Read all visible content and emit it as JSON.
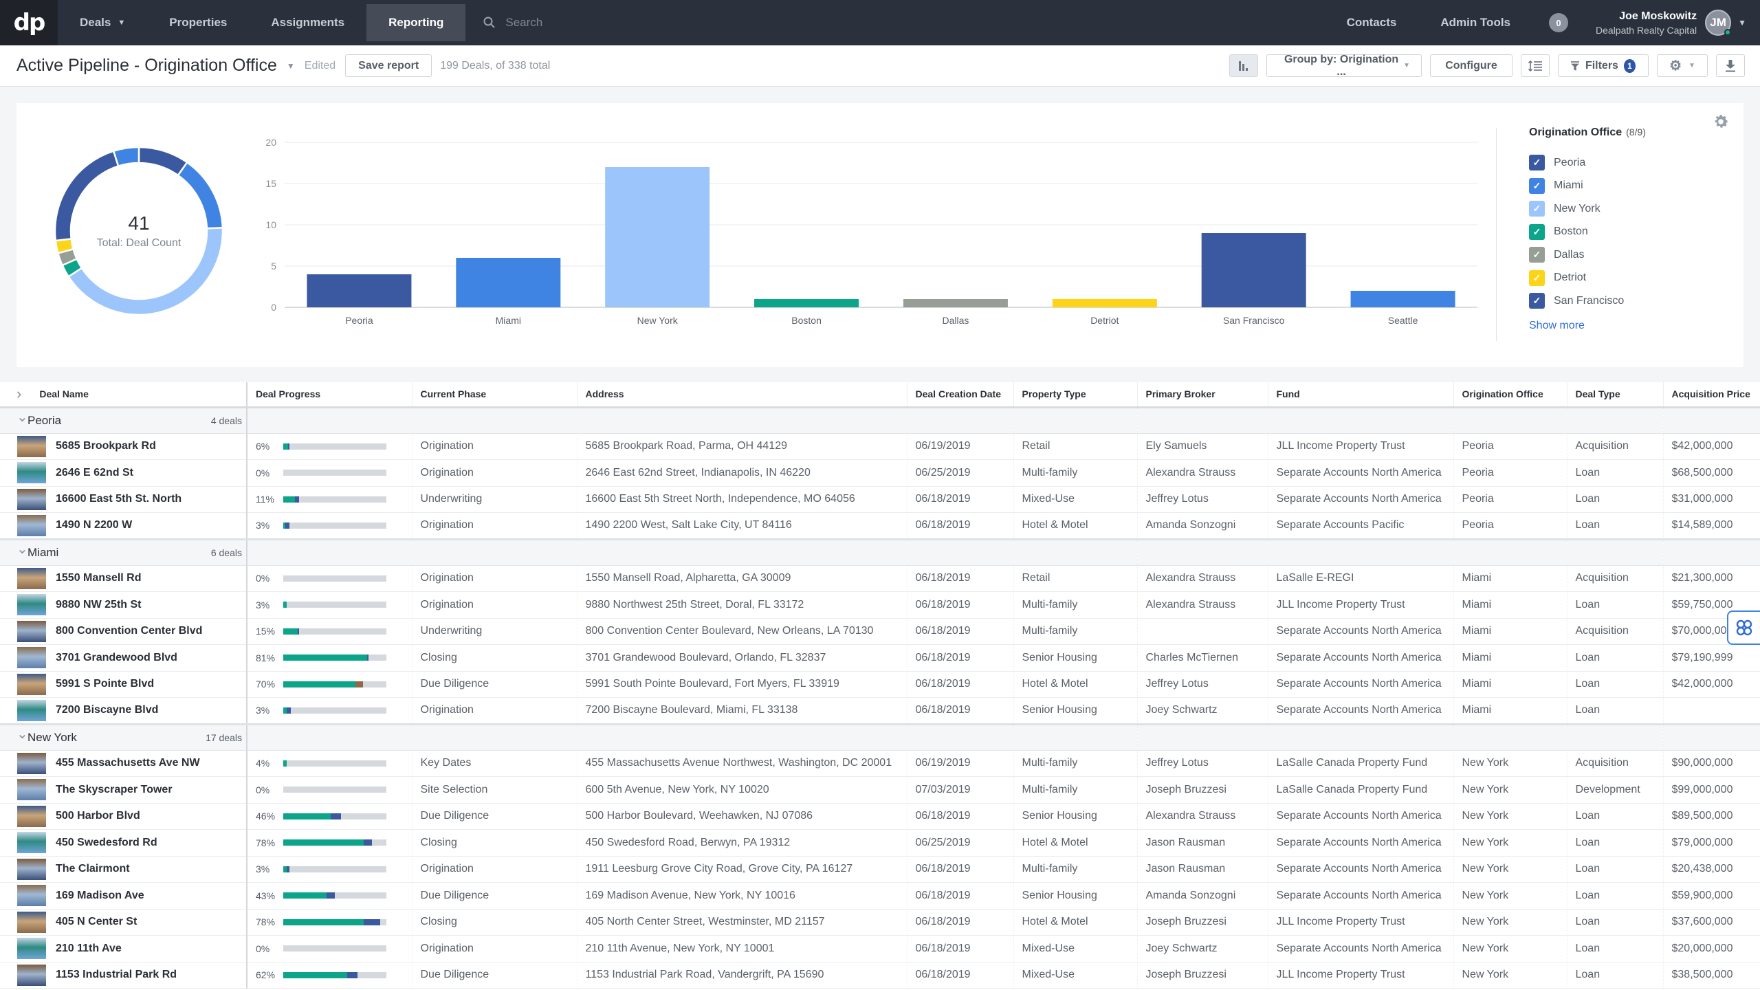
{
  "nav": {
    "logo": "dp",
    "items": [
      {
        "label": "Deals",
        "has_caret": true,
        "active": false
      },
      {
        "label": "Properties",
        "active": false
      },
      {
        "label": "Assignments",
        "active": false
      },
      {
        "label": "Reporting",
        "active": true
      }
    ],
    "search_placeholder": "Search",
    "right_links": [
      "Contacts",
      "Admin Tools"
    ],
    "notification_count": "0",
    "user": {
      "name": "Joe Moskowitz",
      "org": "Dealpath Realty Capital",
      "initials": "JM"
    }
  },
  "titlebar": {
    "title": "Active Pipeline - Origination Office",
    "edited": "Edited",
    "save_label": "Save report",
    "deal_count": "199 Deals, of 338 total",
    "group_by_label": "Group by: Origination ...",
    "configure_label": "Configure",
    "filters_label": "Filters",
    "filters_count": "1"
  },
  "colors": {
    "Peoria": "#3b59a0",
    "Miami": "#4084e3",
    "New York": "#9cc5fb",
    "Boston": "#0ca58a",
    "Dallas": "#979e96",
    "Detriot": "#fdd418",
    "San Francisco": "#3b59a0",
    "Seattle": "#4084e3",
    "progress_primary": "#0ca58a",
    "progress_blue": "#3b59a0",
    "progress_brown": "#8e6a4a",
    "link": "#2d6bd6"
  },
  "chart_data": [
    {
      "type": "pie",
      "variant": "donut",
      "title": "Total: Deal Count",
      "center_value": "41",
      "center_label": "Total: Deal Count",
      "categories": [
        "Peoria",
        "Miami",
        "New York",
        "Boston",
        "Dallas",
        "Detriot",
        "San Francisco",
        "Seattle"
      ],
      "values": [
        4,
        6,
        17,
        1,
        1,
        1,
        9,
        2
      ]
    },
    {
      "type": "bar",
      "title": "",
      "xlabel": "",
      "ylabel": "",
      "categories": [
        "Peoria",
        "Miami",
        "New York",
        "Boston",
        "Dallas",
        "Detriot",
        "San Francisco",
        "Seattle"
      ],
      "values": [
        4,
        6,
        17,
        1,
        1,
        1,
        9,
        2
      ],
      "ylim": [
        0,
        20
      ],
      "yticks": [
        0,
        5,
        10,
        15,
        20
      ],
      "grid": true
    }
  ],
  "legend": {
    "title": "Origination Office",
    "count": "(8/9)",
    "items": [
      "Peoria",
      "Miami",
      "New York",
      "Boston",
      "Dallas",
      "Detriot",
      "San Francisco"
    ],
    "show_more": "Show more"
  },
  "table": {
    "columns": [
      "Deal Name",
      "Deal Progress",
      "Current Phase",
      "Address",
      "Deal Creation Date",
      "Property Type",
      "Primary Broker",
      "Fund",
      "Origination Office",
      "Deal Type",
      "Acquisition Price"
    ],
    "groups": [
      {
        "name": "Peoria",
        "count": "4 deals",
        "rows": [
          {
            "name": "5685 Brookpark Rd",
            "progress": 6,
            "segments": [
              [
                0.045,
                "progress_primary"
              ],
              [
                0.015,
                "progress_blue"
              ]
            ],
            "phase": "Origination",
            "address": "5685 Brookpark Road, Parma, OH 44129",
            "date": "06/19/2019",
            "type": "Retail",
            "broker": "Ely Samuels",
            "fund": "JLL Income Property Trust",
            "office": "Peoria",
            "deal_type": "Acquisition",
            "price": "$42,000,000"
          },
          {
            "name": "2646 E 62nd St",
            "progress": 0,
            "segments": [],
            "phase": "Origination",
            "address": "2646 East 62nd Street, Indianapolis, IN 46220",
            "date": "06/25/2019",
            "type": "Multi-family",
            "broker": "Alexandra Strauss",
            "fund": "Separate Accounts North America",
            "office": "Peoria",
            "deal_type": "Loan",
            "price": "$68,500,000"
          },
          {
            "name": "16600 East 5th St. North",
            "progress": 11,
            "segments": [
              [
                0.11,
                "progress_primary"
              ],
              [
                0.04,
                "progress_blue"
              ]
            ],
            "phase": "Underwriting",
            "address": "16600 East 5th Street North, Independence, MO 64056",
            "date": "06/18/2019",
            "type": "Mixed-Use",
            "broker": "Jeffrey Lotus",
            "fund": "Separate Accounts North America",
            "office": "Peoria",
            "deal_type": "Loan",
            "price": "$31,000,000"
          },
          {
            "name": "1490 N 2200 W",
            "progress": 3,
            "segments": [
              [
                0.02,
                "progress_primary"
              ],
              [
                0.04,
                "progress_blue"
              ]
            ],
            "phase": "Origination",
            "address": "1490 2200 West, Salt Lake City, UT 84116",
            "date": "06/18/2019",
            "type": "Hotel & Motel",
            "broker": "Amanda Sonzogni",
            "fund": "Separate Accounts Pacific",
            "office": "Peoria",
            "deal_type": "Loan",
            "price": "$14,589,000"
          }
        ]
      },
      {
        "name": "Miami",
        "count": "6 deals",
        "rows": [
          {
            "name": "1550 Mansell Rd",
            "progress": 0,
            "segments": [],
            "phase": "Origination",
            "address": "1550 Mansell Road, Alpharetta, GA 30009",
            "date": "06/18/2019",
            "type": "Retail",
            "broker": "Alexandra Strauss",
            "fund": "LaSalle E-REGI",
            "office": "Miami",
            "deal_type": "Acquisition",
            "price": "$21,300,000"
          },
          {
            "name": "9880 NW 25th St",
            "progress": 3,
            "segments": [
              [
                0.03,
                "progress_primary"
              ]
            ],
            "phase": "Origination",
            "address": "9880 Northwest 25th Street, Doral, FL 33172",
            "date": "06/18/2019",
            "type": "Multi-family",
            "broker": "Alexandra Strauss",
            "fund": "JLL Income Property Trust",
            "office": "Miami",
            "deal_type": "Loan",
            "price": "$59,750,000"
          },
          {
            "name": "800 Convention Center Blvd",
            "progress": 15,
            "segments": [
              [
                0.14,
                "progress_primary"
              ],
              [
                0.01,
                "progress_blue"
              ]
            ],
            "phase": "Underwriting",
            "address": "800 Convention Center Boulevard, New Orleans, LA 70130",
            "date": "06/18/2019",
            "type": "Multi-family",
            "broker": "",
            "fund": "Separate Accounts North America",
            "office": "Miami",
            "deal_type": "Acquisition",
            "price": "$70,000,000"
          },
          {
            "name": "3701 Grandewood Blvd",
            "progress": 81,
            "segments": [
              [
                0.81,
                "progress_primary"
              ],
              [
                0.015,
                "progress_blue"
              ]
            ],
            "phase": "Closing",
            "address": "3701 Grandewood Boulevard, Orlando, FL 32837",
            "date": "06/18/2019",
            "type": "Senior Housing",
            "broker": "Charles McTiernen",
            "fund": "Separate Accounts North America",
            "office": "Miami",
            "deal_type": "Loan",
            "price": "$79,190,999"
          },
          {
            "name": "5991 S Pointe Blvd",
            "progress": 70,
            "segments": [
              [
                0.7,
                "progress_primary"
              ],
              [
                0.07,
                "progress_brown"
              ]
            ],
            "phase": "Due Diligence",
            "address": "5991 South Pointe Boulevard, Fort Myers, FL 33919",
            "date": "06/18/2019",
            "type": "Hotel & Motel",
            "broker": "Jeffrey Lotus",
            "fund": "Separate Accounts North America",
            "office": "Miami",
            "deal_type": "Loan",
            "price": "$42,000,000"
          },
          {
            "name": "7200 Biscayne Blvd",
            "progress": 3,
            "segments": [
              [
                0.03,
                "progress_primary"
              ],
              [
                0.04,
                "progress_blue"
              ]
            ],
            "phase": "Origination",
            "address": "7200 Biscayne Boulevard, Miami, FL 33138",
            "date": "06/18/2019",
            "type": "Senior Housing",
            "broker": "Joey Schwartz",
            "fund": "Separate Accounts North America",
            "office": "Miami",
            "deal_type": "Loan",
            "price": ""
          }
        ]
      },
      {
        "name": "New York",
        "count": "17 deals",
        "rows": [
          {
            "name": "455 Massachusetts Ave NW",
            "progress": 4,
            "segments": [
              [
                0.035,
                "progress_primary"
              ]
            ],
            "phase": "Key Dates",
            "address": "455 Massachusetts Avenue Northwest, Washington, DC 20001",
            "date": "06/19/2019",
            "type": "Multi-family",
            "broker": "Jeffrey Lotus",
            "fund": "LaSalle Canada Property Fund",
            "office": "New York",
            "deal_type": "Acquisition",
            "price": "$90,000,000"
          },
          {
            "name": "The Skyscraper Tower",
            "progress": 0,
            "segments": [],
            "phase": "Site Selection",
            "address": "600 5th Avenue, New York, NY 10020",
            "date": "07/03/2019",
            "type": "Multi-family",
            "broker": "Joseph Bruzzesi",
            "fund": "LaSalle Canada Property Fund",
            "office": "New York",
            "deal_type": "Development",
            "price": "$99,000,000"
          },
          {
            "name": "500 Harbor Blvd",
            "progress": 46,
            "segments": [
              [
                0.46,
                "progress_primary"
              ],
              [
                0.1,
                "progress_blue"
              ]
            ],
            "phase": "Due Diligence",
            "address": "500 Harbor Boulevard, Weehawken, NJ 07086",
            "date": "06/18/2019",
            "type": "Senior Housing",
            "broker": "Alexandra Strauss",
            "fund": "Separate Accounts North America",
            "office": "New York",
            "deal_type": "Loan",
            "price": "$89,500,000"
          },
          {
            "name": "450 Swedesford Rd",
            "progress": 78,
            "segments": [
              [
                0.78,
                "progress_primary"
              ],
              [
                0.08,
                "progress_blue"
              ]
            ],
            "phase": "Closing",
            "address": "450 Swedesford Road, Berwyn, PA 19312",
            "date": "06/25/2019",
            "type": "Hotel & Motel",
            "broker": "Jason Rausman",
            "fund": "Separate Accounts North America",
            "office": "New York",
            "deal_type": "Loan",
            "price": "$79,000,000"
          },
          {
            "name": "The Clairmont",
            "progress": 3,
            "segments": [
              [
                0.03,
                "progress_primary"
              ],
              [
                0.03,
                "progress_blue"
              ]
            ],
            "phase": "Origination",
            "address": "1911 Leesburg Grove City Road, Grove City, PA 16127",
            "date": "06/18/2019",
            "type": "Multi-family",
            "broker": "Jason Rausman",
            "fund": "Separate Accounts North America",
            "office": "New York",
            "deal_type": "Loan",
            "price": "$20,438,000"
          },
          {
            "name": "169 Madison Ave",
            "progress": 43,
            "segments": [
              [
                0.42,
                "progress_primary"
              ],
              [
                0.08,
                "progress_blue"
              ]
            ],
            "phase": "Due Diligence",
            "address": "169 Madison Avenue, New York, NY 10016",
            "date": "06/18/2019",
            "type": "Senior Housing",
            "broker": "Amanda Sonzogni",
            "fund": "Separate Accounts North America",
            "office": "New York",
            "deal_type": "Loan",
            "price": "$59,900,000"
          },
          {
            "name": "405 N Center St",
            "progress": 78,
            "segments": [
              [
                0.78,
                "progress_primary"
              ],
              [
                0.16,
                "progress_blue"
              ]
            ],
            "phase": "Closing",
            "address": "405 North Center Street, Westminster, MD 21157",
            "date": "06/18/2019",
            "type": "Hotel & Motel",
            "broker": "Joseph Bruzzesi",
            "fund": "JLL Income Property Trust",
            "office": "New York",
            "deal_type": "Loan",
            "price": "$37,600,000"
          },
          {
            "name": "210 11th Ave",
            "progress": 0,
            "segments": [],
            "phase": "Origination",
            "address": "210 11th Avenue, New York, NY 10001",
            "date": "06/18/2019",
            "type": "Mixed-Use",
            "broker": "Joey Schwartz",
            "fund": "Separate Accounts North America",
            "office": "New York",
            "deal_type": "Loan",
            "price": "$20,000,000"
          },
          {
            "name": "1153 Industrial Park Rd",
            "progress": 62,
            "segments": [
              [
                0.62,
                "progress_primary"
              ],
              [
                0.1,
                "progress_blue"
              ]
            ],
            "phase": "Due Diligence",
            "address": "1153 Industrial Park Road, Vandergrift, PA 15690",
            "date": "06/18/2019",
            "type": "Mixed-Use",
            "broker": "Joseph Bruzzesi",
            "fund": "JLL Income Property Trust",
            "office": "New York",
            "deal_type": "Loan",
            "price": "$38,500,000"
          }
        ]
      }
    ]
  }
}
